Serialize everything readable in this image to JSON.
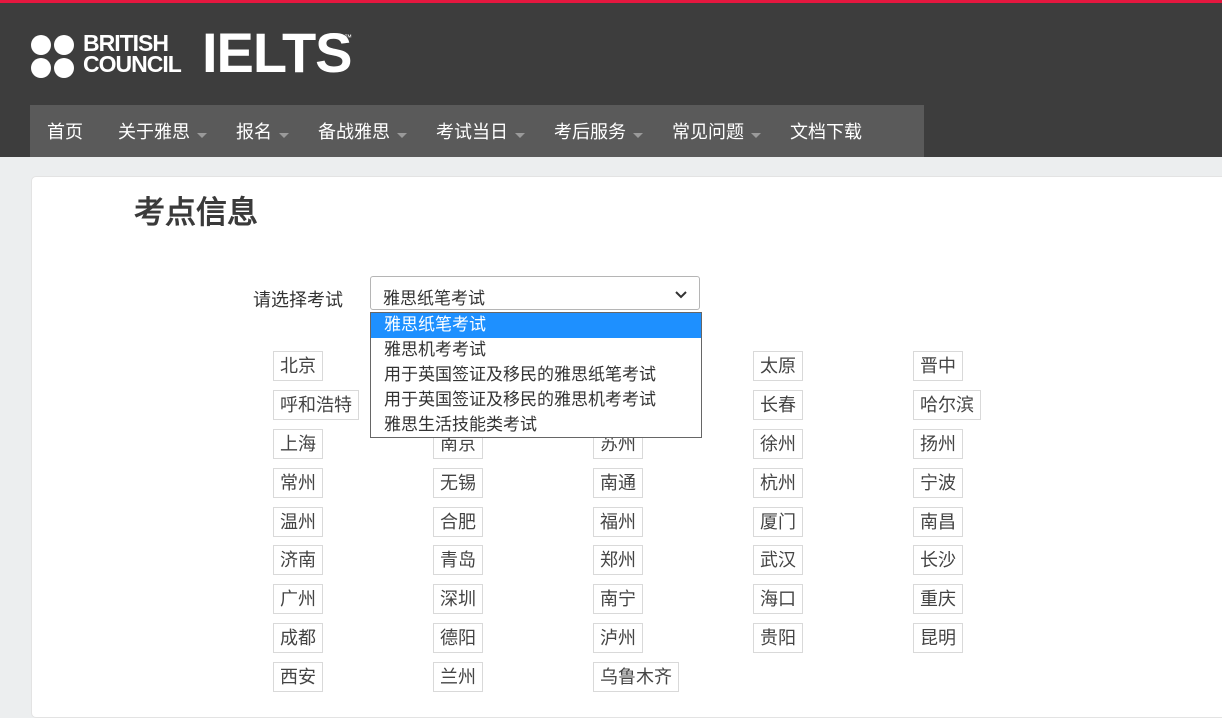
{
  "brand": {
    "british": "BRITISH",
    "council": "COUNCIL",
    "ielts": "IELTS",
    "tm": "™",
    "accent_color": "#e5173f"
  },
  "nav": {
    "items": [
      {
        "label": "首页",
        "has_dropdown": false
      },
      {
        "label": "关于雅思",
        "has_dropdown": true
      },
      {
        "label": "报名",
        "has_dropdown": true
      },
      {
        "label": "备战雅思",
        "has_dropdown": true
      },
      {
        "label": "考试当日",
        "has_dropdown": true
      },
      {
        "label": "考后服务",
        "has_dropdown": true
      },
      {
        "label": "常见问题",
        "has_dropdown": true
      },
      {
        "label": "文档下载",
        "has_dropdown": false
      }
    ]
  },
  "page": {
    "title": "考点信息"
  },
  "exam_select": {
    "label": "请选择考试",
    "value": "雅思纸笔考试",
    "options": [
      "雅思纸笔考试",
      "雅思机考考试",
      "用于英国签证及移民的雅思纸笔考试",
      "用于英国签证及移民的雅思机考考试",
      "雅思生活技能类考试"
    ],
    "selected_index": 0,
    "highlight_color": "#1e90ff"
  },
  "cities": [
    [
      "北京",
      "",
      "",
      "太原",
      "晋中"
    ],
    [
      "呼和浩特",
      "",
      "",
      "长春",
      "哈尔滨"
    ],
    [
      "上海",
      "南京",
      "苏州",
      "徐州",
      "扬州"
    ],
    [
      "常州",
      "无锡",
      "南通",
      "杭州",
      "宁波"
    ],
    [
      "温州",
      "合肥",
      "福州",
      "厦门",
      "南昌"
    ],
    [
      "济南",
      "青岛",
      "郑州",
      "武汉",
      "长沙"
    ],
    [
      "广州",
      "深圳",
      "南宁",
      "海口",
      "重庆"
    ],
    [
      "成都",
      "德阳",
      "泸州",
      "贵阳",
      "昆明"
    ],
    [
      "西安",
      "兰州",
      "乌鲁木齐",
      "",
      ""
    ]
  ]
}
